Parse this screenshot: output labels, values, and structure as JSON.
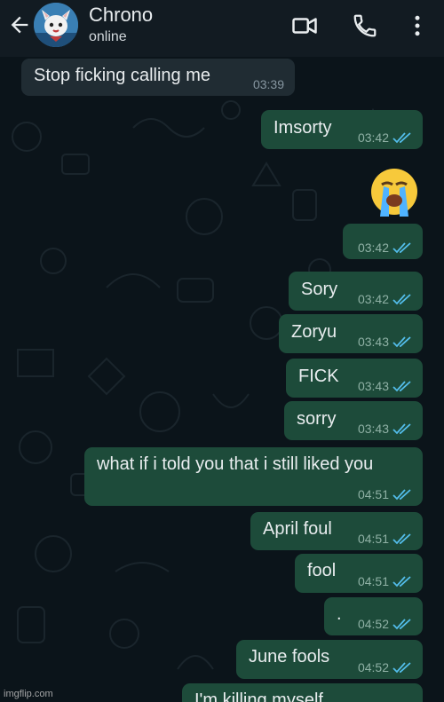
{
  "header": {
    "contact_name": "Chrono",
    "status": "online",
    "icons": [
      "back-arrow-icon",
      "video-call-icon",
      "voice-call-icon",
      "more-options-icon"
    ]
  },
  "messages": [
    {
      "dir": "in",
      "text": "Stop ficking calling me",
      "time": "03:39"
    },
    {
      "dir": "out",
      "text": "Imsorty",
      "time": "03:42"
    },
    {
      "dir": "out",
      "emoji": "loudly-crying-face",
      "text": "",
      "time": "03:42"
    },
    {
      "dir": "out",
      "text": "Sory",
      "time": "03:42"
    },
    {
      "dir": "out",
      "text": "Zoryu",
      "time": "03:43"
    },
    {
      "dir": "out",
      "text": "FICK",
      "time": "03:43"
    },
    {
      "dir": "out",
      "text": "sorry",
      "time": "03:43"
    },
    {
      "dir": "out",
      "text": "what if i told you that i still liked you",
      "time": "04:51"
    },
    {
      "dir": "out",
      "text": "April foul",
      "time": "04:51"
    },
    {
      "dir": "out",
      "text": "fool",
      "time": "04:51"
    },
    {
      "dir": "out",
      "text": ".",
      "time": "04:52"
    },
    {
      "dir": "out",
      "text": "June fools",
      "time": "04:52"
    },
    {
      "dir": "out",
      "text": "I'm killing myself",
      "time": ""
    }
  ],
  "watermark": "imgflip.com",
  "colors": {
    "background": "#0b141a",
    "header": "#121b22",
    "outgoing_bubble": "#1d4b3a",
    "incoming_bubble": "#202c33",
    "read_ticks": "#53bdeb"
  }
}
